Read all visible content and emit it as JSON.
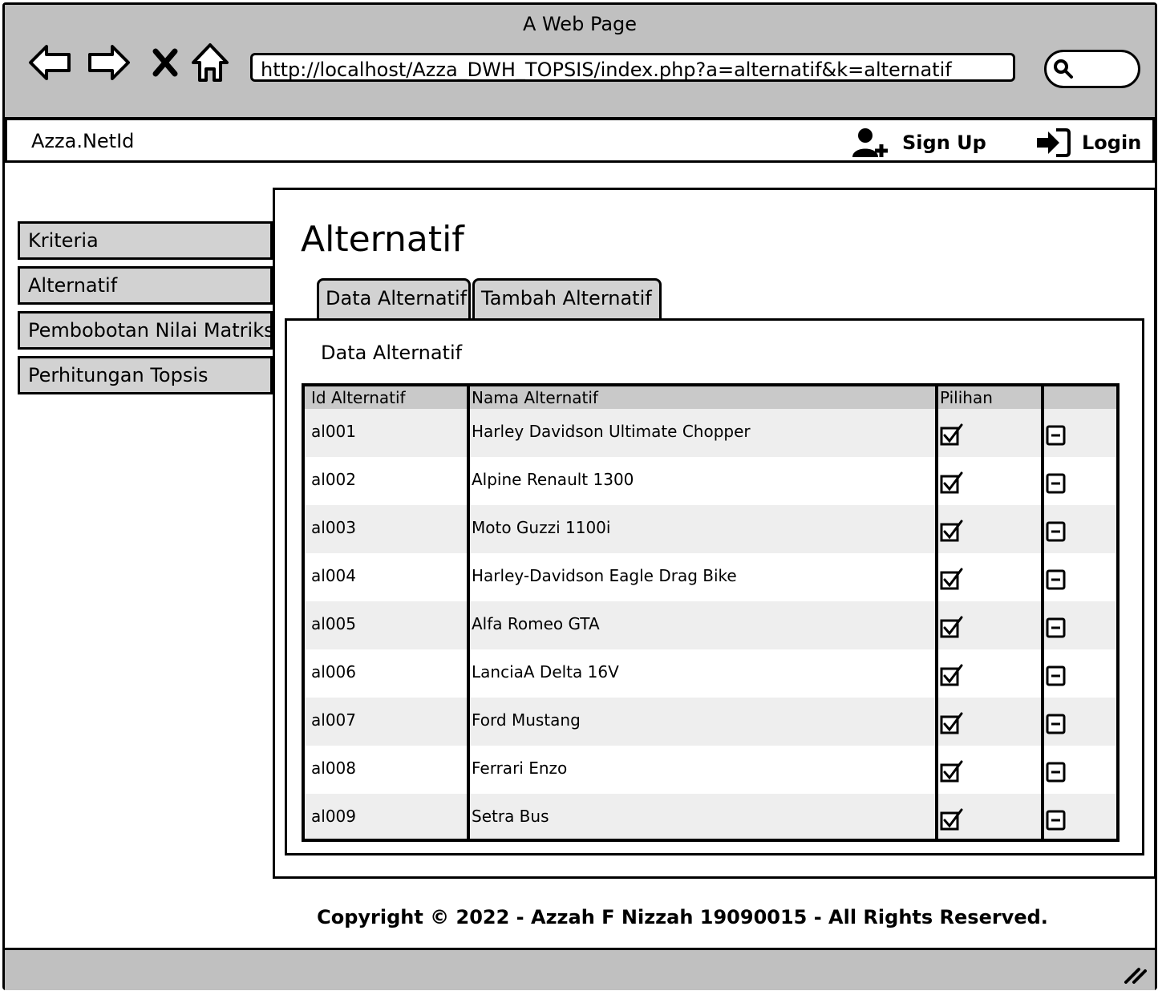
{
  "window": {
    "title": "A Web Page",
    "url": "http://localhost/Azza_DWH_TOPSIS/index.php?a=alternatif&k=alternatif"
  },
  "topnav": {
    "brand": "Azza.NetId",
    "signup_label": "Sign Up",
    "login_label": "Login"
  },
  "sidebar": {
    "items": [
      {
        "label": "Kriteria"
      },
      {
        "label": "Alternatif"
      },
      {
        "label": "Pembobotan Nilai Matriks"
      },
      {
        "label": "Perhitungan Topsis"
      }
    ]
  },
  "main": {
    "title": "Alternatif",
    "tabs": [
      {
        "label": "Data Alternatif"
      },
      {
        "label": "Tambah Alternatif"
      }
    ],
    "panel_title": "Data Alternatif",
    "table": {
      "headers": [
        "Id Alternatif",
        "Nama Alternatif",
        "Pilihan",
        ""
      ],
      "rows": [
        {
          "id": "al001",
          "name": "Harley Davidson Ultimate Chopper"
        },
        {
          "id": "al002",
          "name": "Alpine Renault 1300"
        },
        {
          "id": "al003",
          "name": "Moto Guzzi 1100i"
        },
        {
          "id": "al004",
          "name": "Harley-Davidson Eagle Drag Bike"
        },
        {
          "id": "al005",
          "name": "Alfa Romeo GTA"
        },
        {
          "id": "al006",
          "name": "LanciaA Delta 16V"
        },
        {
          "id": "al007",
          "name": "Ford Mustang"
        },
        {
          "id": "al008",
          "name": "Ferrari Enzo"
        },
        {
          "id": "al009",
          "name": "Setra Bus"
        }
      ]
    }
  },
  "footer": {
    "text": "Copyright © 2022 - Azzah F Nizzah 19090015 - All Rights Reserved."
  },
  "icons": [
    "back-arrow-icon",
    "forward-arrow-icon",
    "close-icon",
    "home-icon",
    "search-icon",
    "add-user-icon",
    "login-icon",
    "checkbox-checked-icon",
    "minus-box-icon",
    "resize-grip-icon"
  ]
}
